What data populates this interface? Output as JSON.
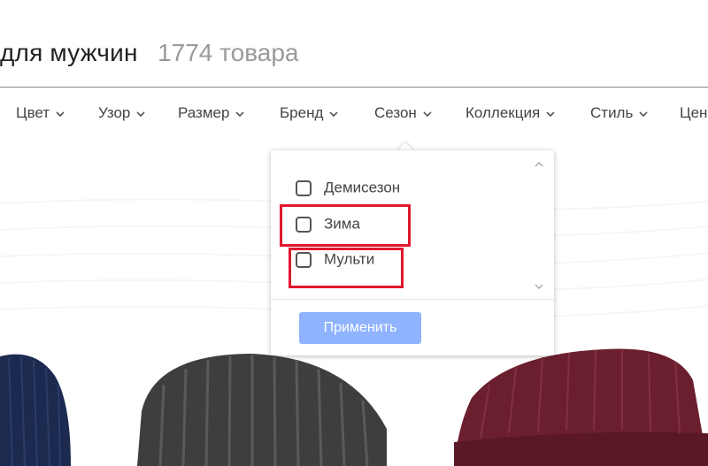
{
  "header": {
    "title": "для мужчин",
    "count": "1774 товара"
  },
  "filters": [
    {
      "label": "Цвет"
    },
    {
      "label": "Узор"
    },
    {
      "label": "Размер"
    },
    {
      "label": "Бренд"
    },
    {
      "label": "Сезон",
      "open": true
    },
    {
      "label": "Коллекция"
    },
    {
      "label": "Стиль"
    },
    {
      "label": "Цен"
    }
  ],
  "season_dropdown": {
    "options": [
      {
        "label": "Демисезон",
        "checked": false
      },
      {
        "label": "Зима",
        "checked": false,
        "highlighted": true
      },
      {
        "label": "Мульти",
        "checked": false,
        "highlighted": true
      }
    ],
    "apply_label": "Применить"
  },
  "colors": {
    "apply_button": "#8fb3ff",
    "highlight": "#e0182d",
    "hat_navy": "#1d2a4f",
    "hat_gray": "#3e3e3e",
    "hat_burgundy": "#6b1f2e"
  },
  "products": [
    {
      "color_name": "navy",
      "icon": "beanie-image"
    },
    {
      "color_name": "gray",
      "icon": "beanie-image"
    },
    {
      "color_name": "burgundy",
      "icon": "beanie-image"
    }
  ]
}
